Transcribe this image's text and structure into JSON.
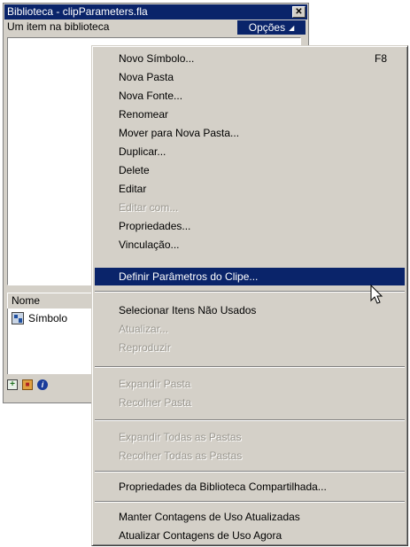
{
  "library_panel": {
    "title": "Biblioteca - clipParameters.fla",
    "close_symbol": "✕",
    "item_count_text": "Um item na biblioteca",
    "options_label": "Opções",
    "column_header": "Nome",
    "list_items": [
      {
        "label": "Símbolo",
        "icon": "movie-clip-icon"
      }
    ],
    "bottom_icons": [
      "new-symbol-icon",
      "new-folder-icon",
      "properties-icon"
    ]
  },
  "context_menu": {
    "items": [
      {
        "label": "Novo Símbolo...",
        "shortcut": "F8",
        "enabled": true
      },
      {
        "label": "Nova Pasta",
        "enabled": true
      },
      {
        "label": "Nova Fonte...",
        "enabled": true
      },
      {
        "label": "Renomear",
        "enabled": true
      },
      {
        "label": "Mover para Nova Pasta...",
        "enabled": true
      },
      {
        "label": "Duplicar...",
        "enabled": true
      },
      {
        "label": "Delete",
        "enabled": true
      },
      {
        "label": "Editar",
        "enabled": true
      },
      {
        "label": "Editar com...",
        "enabled": false
      },
      {
        "label": "Propriedades...",
        "enabled": true
      },
      {
        "label": "Vinculação...",
        "enabled": true
      },
      {
        "label": "Definir Parâmetros do Clipe...",
        "enabled": true,
        "selected": true
      },
      {
        "label": "Selecionar Itens Não Usados",
        "enabled": true
      },
      {
        "label": "Atualizar...",
        "enabled": false
      },
      {
        "label": "Reproduzir",
        "enabled": false
      },
      {
        "label": "Expandir Pasta",
        "enabled": false
      },
      {
        "label": "Recolher Pasta",
        "enabled": false
      },
      {
        "label": "Expandir Todas as Pastas",
        "enabled": false
      },
      {
        "label": "Recolher Todas as Pastas",
        "enabled": false
      },
      {
        "label": "Propriedades da Biblioteca Compartilhada...",
        "enabled": true
      },
      {
        "label": "Manter Contagens de Uso Atualizadas",
        "enabled": true
      },
      {
        "label": "Atualizar Contagens de Uso Agora",
        "enabled": true
      }
    ]
  },
  "colors": {
    "highlight": "#0a246a",
    "face": "#d4d0c8",
    "disabled_text": "#9a978f"
  }
}
